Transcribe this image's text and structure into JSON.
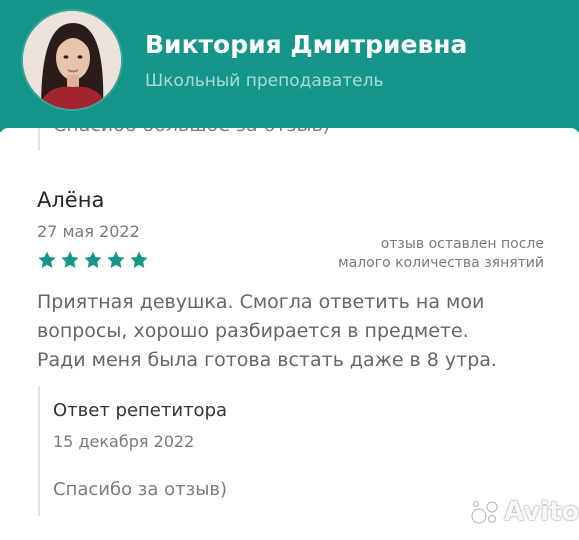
{
  "header": {
    "teacher_name": "Виктория Дмитриевна",
    "teacher_role": "Школьный преподаватель",
    "background_color": "#16968a"
  },
  "previous_reply": {
    "text": "Спасибо большое за отзыв)"
  },
  "review": {
    "reviewer_name": "Алёна",
    "date": "27 мая 2022",
    "rating": 5,
    "rating_max": 5,
    "star_color": "#16968a",
    "note_lines": [
      "отзыв оставлен после",
      "малого количества зянятий"
    ],
    "body_lines": [
      "Приятная девушка. Смогла ответить на мои",
      "вопросы, хорошо разбирается в предмете.",
      "Ради меня была готова встать даже в 8 утра."
    ]
  },
  "tutor_reply": {
    "title": "Ответ репетитора",
    "date": "15 декабря 2022",
    "text": "Спасибо за отзыв)"
  },
  "watermark": {
    "logo": "avito-logo"
  }
}
